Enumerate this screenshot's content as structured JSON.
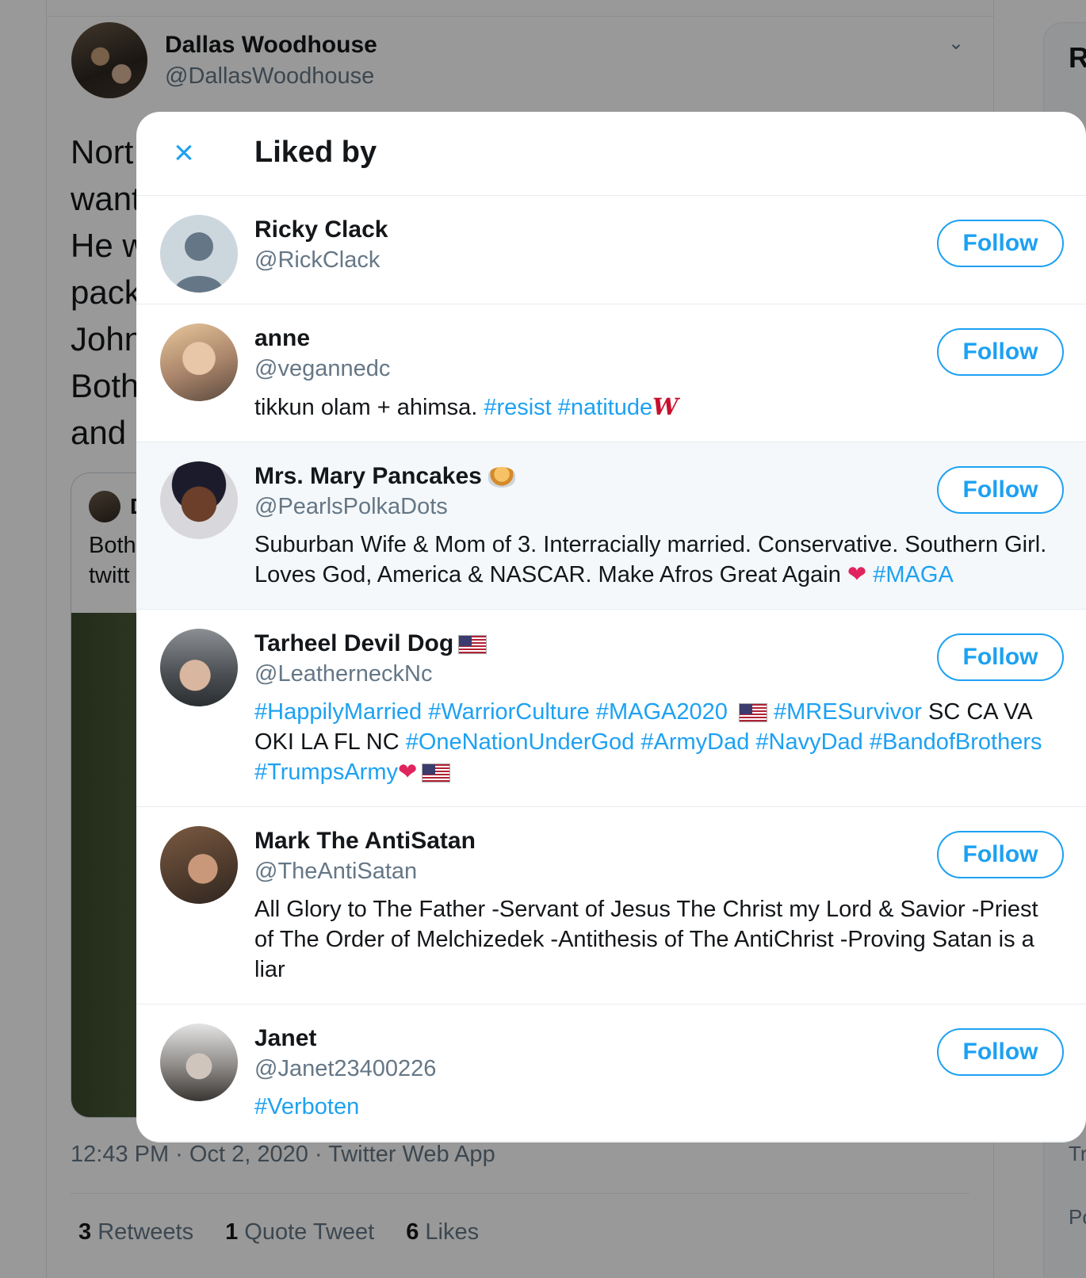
{
  "background": {
    "author_name": "Dallas Woodhouse",
    "author_handle": "@DallasWoodhouse",
    "tweet_lines": [
      "Nort",
      "want",
      "He w",
      "pack",
      "John",
      "Both",
      "and"
    ],
    "quote_name": "D",
    "quote_text_lines": [
      "Both",
      "twitt"
    ],
    "meta": "12:43 PM · Oct 2, 2020 · Twitter Web App",
    "stats": {
      "retweets_count": "3",
      "retweets_label": "Retweets",
      "quotes_count": "1",
      "quotes_label": "Quote Tweet",
      "likes_count": "6",
      "likes_label": "Likes"
    },
    "right_col": [
      "R",
      "Tr",
      "Po"
    ]
  },
  "modal": {
    "title": "Liked by",
    "follow_label": "Follow",
    "users": [
      {
        "name": "Ricky Clack",
        "handle": "@RickClack",
        "bio": ""
      },
      {
        "name": "anne",
        "handle": "@vegannedc",
        "bio_text": "tikkun olam + ahimsa. ",
        "bio_tags": "#resist #natitude"
      },
      {
        "name": "Mrs. Mary Pancakes",
        "handle": "@PearlsPolkaDots",
        "bio_text": "Suburban Wife & Mom of 3. Interracially married. Conservative. Southern Girl. Loves God, America & NASCAR. Make Afros Great Again ",
        "bio_tags": "#MAGA"
      },
      {
        "name": "Tarheel Devil Dog",
        "handle": "@LeatherneckNc",
        "bio_tag1": "#HappilyMarried #WarriorCulture #MAGA2020",
        "bio_tag2": "#MRESurvivor",
        "bio_text2": " SC CA VA OKI LA FL NC ",
        "bio_tag3": "#OneNationUnderGod #ArmyDad #NavyDad #BandofBrothers #TrumpsArmy"
      },
      {
        "name": "Mark The AntiSatan",
        "handle": "@TheAntiSatan",
        "bio": "All Glory to The Father -Servant of Jesus The Christ my Lord & Savior -Priest of The Order of Melchizedek -Antithesis of The AntiChrist -Proving Satan is a liar"
      },
      {
        "name": "Janet",
        "handle": "@Janet23400226",
        "bio_tags": "#Verboten"
      }
    ]
  }
}
